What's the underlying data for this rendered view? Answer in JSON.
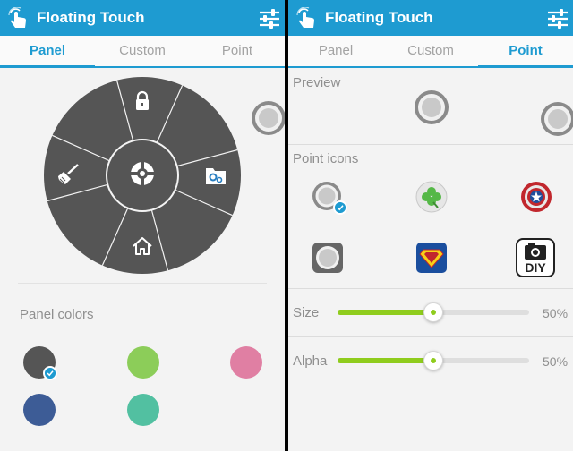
{
  "app_title": "Floating Touch",
  "tabs": [
    "Panel",
    "Custom",
    "Point"
  ],
  "panel_screen": {
    "active_tab": "Panel",
    "wheel_icons": [
      "lock-icon",
      "app-manager-icon",
      "home-icon",
      "broom-icon",
      "center-grip-icon"
    ],
    "colors_label": "Panel colors",
    "colors": [
      {
        "hex": "#555555",
        "selected": true
      },
      {
        "hex": "#8ccd59",
        "selected": false
      },
      {
        "hex": "#e07fa3",
        "selected": false
      },
      {
        "hex": "#3d5c96",
        "selected": false
      },
      {
        "hex": "#52c0a1",
        "selected": false
      }
    ]
  },
  "point_screen": {
    "active_tab": "Point",
    "preview_label": "Preview",
    "point_icons_label": "Point icons",
    "point_icons": [
      {
        "name": "grey-ring-point-icon",
        "selected": true
      },
      {
        "name": "clover-point-icon",
        "selected": false
      },
      {
        "name": "shield-point-icon",
        "selected": false
      },
      {
        "name": "square-ring-point-icon",
        "selected": false
      },
      {
        "name": "superman-point-icon",
        "selected": false
      },
      {
        "name": "diy-camera-point-icon",
        "selected": false,
        "text": "DIY"
      }
    ],
    "size": {
      "label": "Size",
      "value_text": "50%",
      "level": 0.5
    },
    "alpha": {
      "label": "Alpha",
      "value_text": "50%",
      "level": 0.5
    }
  },
  "colors": {
    "accent": "#1e9bd1",
    "slider": "#8fcc1d",
    "wheel": "#555555"
  }
}
